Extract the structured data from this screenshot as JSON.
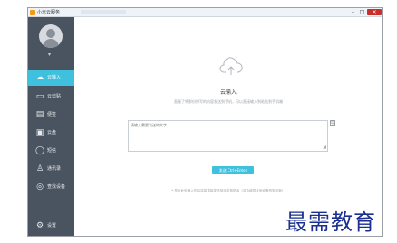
{
  "window": {
    "title": "小米云服务",
    "controls": {
      "minimize": "–",
      "maximize": "□",
      "close": "✕"
    }
  },
  "sidebar": {
    "items": [
      {
        "label": "云输入",
        "icon": "cloud-upload-icon",
        "active": true
      },
      {
        "label": "云剪贴",
        "icon": "clipboard-icon",
        "active": false
      },
      {
        "label": "便签",
        "icon": "note-icon",
        "active": false
      },
      {
        "label": "云盘",
        "icon": "disk-icon",
        "active": false
      },
      {
        "label": "短信",
        "icon": "message-icon",
        "active": false
      },
      {
        "label": "通讯录",
        "icon": "contacts-icon",
        "active": false
      },
      {
        "label": "查找设备",
        "icon": "locate-device-icon",
        "active": false
      }
    ],
    "settings_label": "设置"
  },
  "main": {
    "title": "云输入",
    "subtitle": "直接了将那份所写的内容发送到手机，可以直接输入到粘贴到手机端",
    "input": {
      "placeholder": "请输入需要发送的文字"
    },
    "send_label": "发送 Ctrl+Enter",
    "tip": "* 您在此处输入的内容将直接发送到手机剪贴板（这会被同步到设备的剪贴板）"
  },
  "watermark": "最需教育",
  "colors": {
    "accent": "#3fc0dc",
    "sidebar_bg": "#4a5360",
    "window_close": "#c9302c"
  }
}
